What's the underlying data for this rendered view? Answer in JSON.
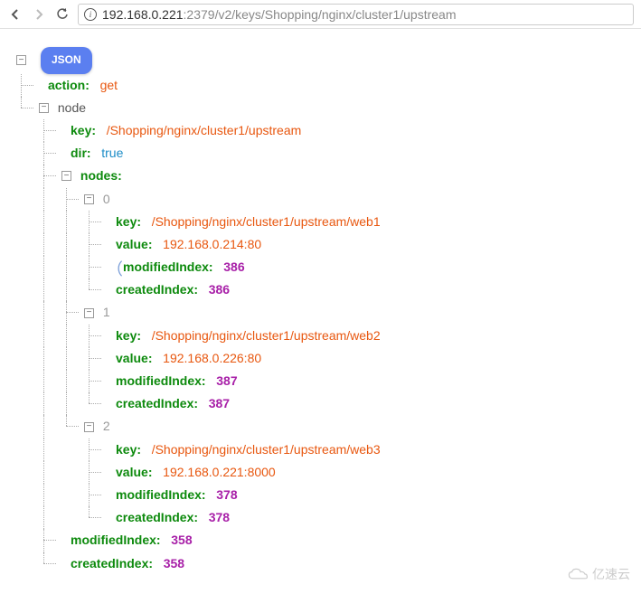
{
  "url": {
    "host": "192.168.0.221",
    "path": ":2379/v2/keys/Shopping/nginx/cluster1/upstream"
  },
  "badge": "JSON",
  "root": {
    "action_k": "action",
    "action_v": "get",
    "node_k": "node",
    "node": {
      "key_k": "key",
      "key_v": "/Shopping/nginx/cluster1/upstream",
      "dir_k": "dir",
      "dir_v": "true",
      "nodes_k": "nodes",
      "nodes": [
        {
          "idx": "0",
          "key": "/Shopping/nginx/cluster1/upstream/web1",
          "value": "192.168.0.214:80",
          "modifiedIndex": "386",
          "createdIndex": "386"
        },
        {
          "idx": "1",
          "key": "/Shopping/nginx/cluster1/upstream/web2",
          "value": "192.168.0.226:80",
          "modifiedIndex": "387",
          "createdIndex": "387"
        },
        {
          "idx": "2",
          "key": "/Shopping/nginx/cluster1/upstream/web3",
          "value": "192.168.0.221:8000",
          "modifiedIndex": "378",
          "createdIndex": "378"
        }
      ],
      "modifiedIndex_k": "modifiedIndex",
      "modifiedIndex_v": "358",
      "createdIndex_k": "createdIndex",
      "createdIndex_v": "358"
    }
  },
  "labels": {
    "key": "key",
    "value": "value",
    "modifiedIndex": "modifiedIndex",
    "createdIndex": "createdIndex"
  },
  "watermark": "亿速云"
}
